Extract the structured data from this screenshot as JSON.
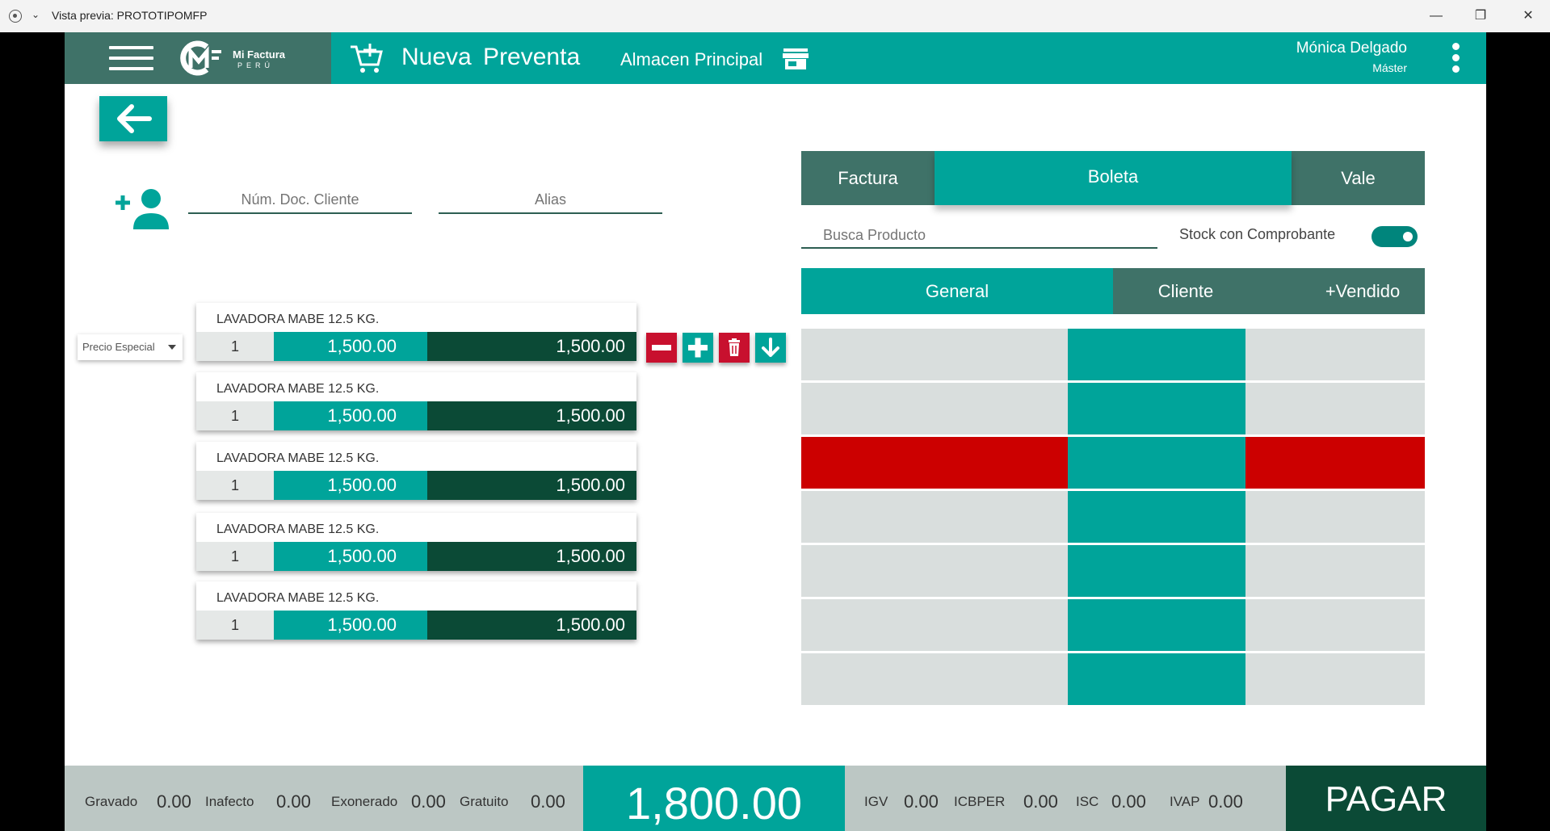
{
  "window": {
    "title": "Vista previa: PROTOTIPOMFP",
    "min": "—",
    "max": "❐",
    "close": "✕"
  },
  "header": {
    "logo_name": "Mi Factura",
    "logo_country": "PERÚ",
    "title": "Nueva Preventa",
    "store": "Almacen Principal",
    "user_name": "Mónica Delgado",
    "user_role": "Máster"
  },
  "client": {
    "doc_placeholder": "Núm. Doc. Cliente",
    "alias_placeholder": "Alias"
  },
  "price_select": {
    "value": "Precio Especial"
  },
  "items": [
    {
      "name": "LAVADORA MABE 12.5 KG.",
      "qty": "1",
      "price": "1,500.00",
      "total": "1,500.00"
    },
    {
      "name": "LAVADORA MABE 12.5 KG.",
      "qty": "1",
      "price": "1,500.00",
      "total": "1,500.00"
    },
    {
      "name": "LAVADORA MABE 12.5 KG.",
      "qty": "1",
      "price": "1,500.00",
      "total": "1,500.00"
    },
    {
      "name": "LAVADORA MABE 12.5 KG.",
      "qty": "1",
      "price": "1,500.00",
      "total": "1,500.00"
    },
    {
      "name": "LAVADORA MABE 12.5 KG.",
      "qty": "1",
      "price": "1,500.00",
      "total": "1,500.00"
    }
  ],
  "doc_tabs": {
    "factura": "Factura",
    "boleta": "Boleta",
    "vale": "Vale"
  },
  "search": {
    "placeholder": "Busca Producto",
    "stock_label": "Stock con Comprobante"
  },
  "sub_tabs": {
    "general": "General",
    "cliente": "Cliente",
    "vendido": "+Vendido"
  },
  "colors": {
    "teal": "#00a49a",
    "dark_green": "#0b4a36",
    "red": "#cc0000",
    "grid_gray": "#d9dedd"
  },
  "footer": {
    "gravado_label": "Gravado",
    "gravado": "0.00",
    "inafecto_label": "Inafecto",
    "inafecto": "0.00",
    "exonerado_label": "Exonerado",
    "exonerado": "0.00",
    "gratuito_label": "Gratuito",
    "gratuito": "0.00",
    "total": "1,800.00",
    "igv_label": "IGV",
    "igv": "0.00",
    "icbper_label": "ICBPER",
    "icbper": "0.00",
    "isc_label": "ISC",
    "isc": "0.00",
    "ivap_label": "IVAP",
    "ivap": "0.00",
    "pay_label": "PAGAR"
  }
}
